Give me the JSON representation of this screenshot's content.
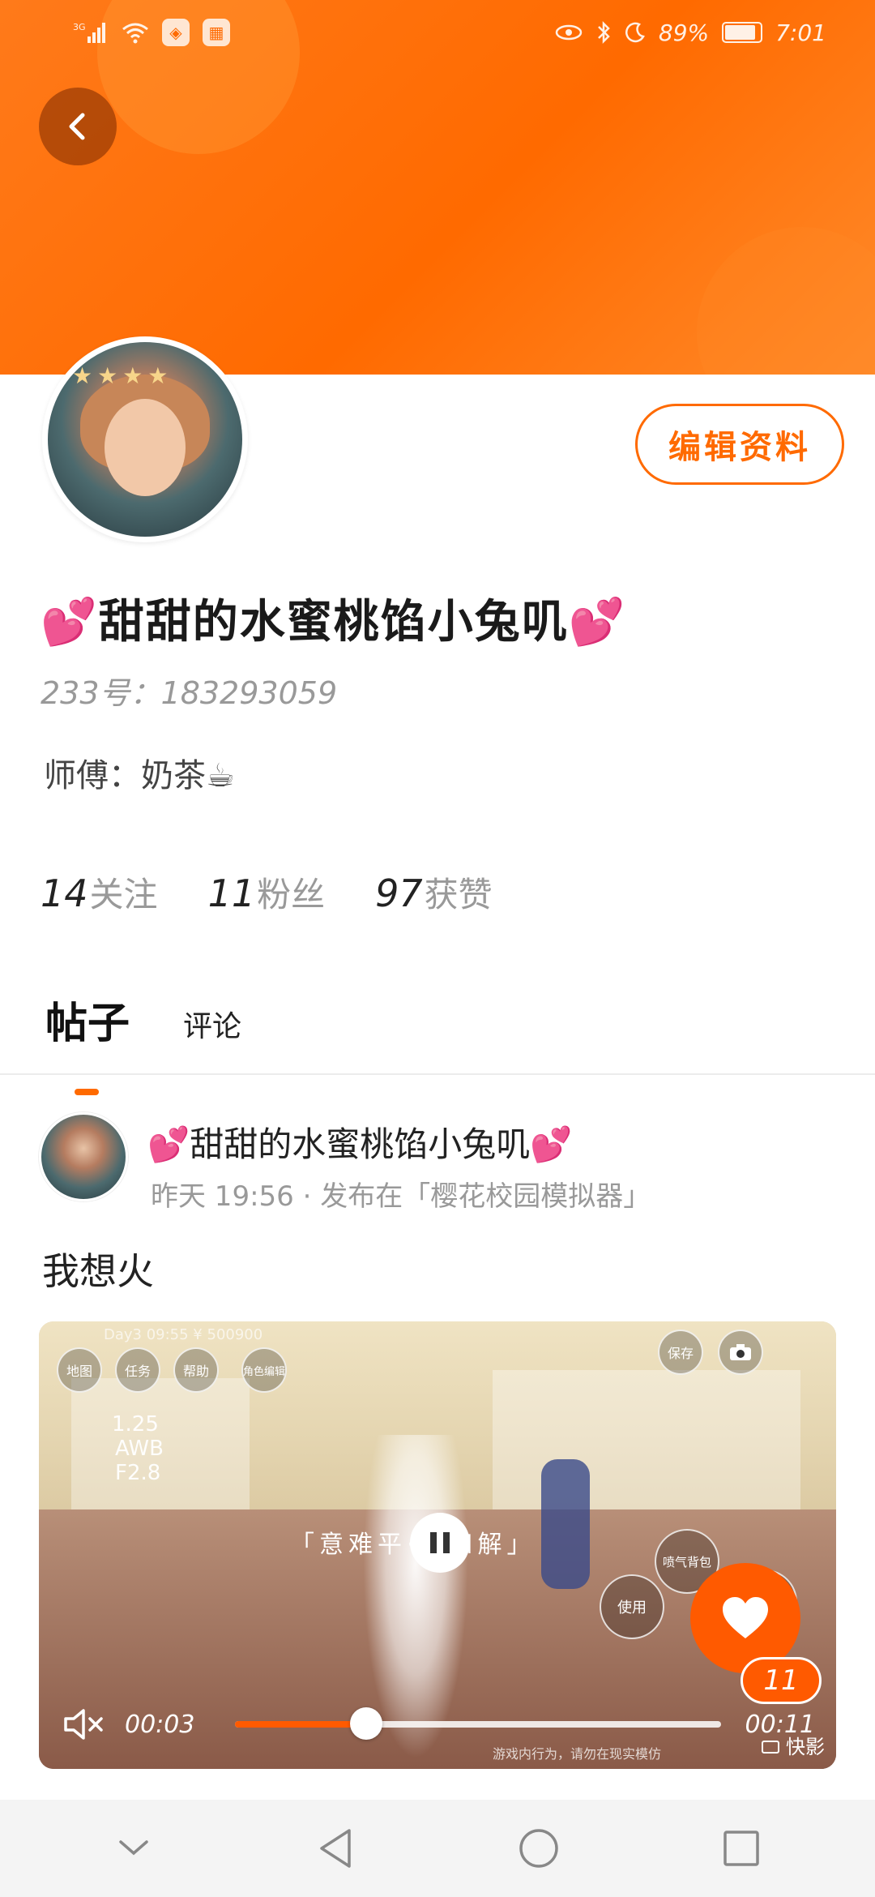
{
  "statusbar": {
    "network": "3G",
    "battery": "89%",
    "time": "7:01"
  },
  "profile": {
    "edit_label": "编辑资料",
    "username": "💕甜甜的水蜜桃馅小兔叽💕",
    "uid_label": "233号：",
    "uid": "183293059",
    "master_label": "师傅：",
    "master_name": "奶茶☕"
  },
  "stats": [
    {
      "num": "14",
      "label": "关注"
    },
    {
      "num": "11",
      "label": "粉丝"
    },
    {
      "num": "97",
      "label": "获赞"
    }
  ],
  "tabs": {
    "posts": "帖子",
    "comments": "评论"
  },
  "post": {
    "author": "💕甜甜的水蜜桃馅小兔叽💕",
    "time": "昨天 19:56",
    "separator": "·",
    "published_in": "发布在「樱花校园模拟器」",
    "title": "我想火",
    "video": {
      "hud_top": "Day3 09:55  ¥ 500900",
      "hud_map": "地图",
      "hud_task": "任务",
      "hud_help": "帮助",
      "hud_role": "角色编辑",
      "hud_save": "保存",
      "hud_iso": "1.25",
      "hud_awb": "AWB",
      "hud_f": "F2.8",
      "subtitle": "「意难平·将和解」",
      "hud_spray": "喷气背包",
      "hud_use": "使用",
      "hud_jump": "跳",
      "hud_ingame": "游戏内行为，请勿在现实模仿",
      "current_time": "00:03",
      "duration": "00:11",
      "progress_fraction": 0.27,
      "watermark": "快影"
    },
    "likes": "11"
  },
  "colors": {
    "accent": "#ff6a00"
  }
}
